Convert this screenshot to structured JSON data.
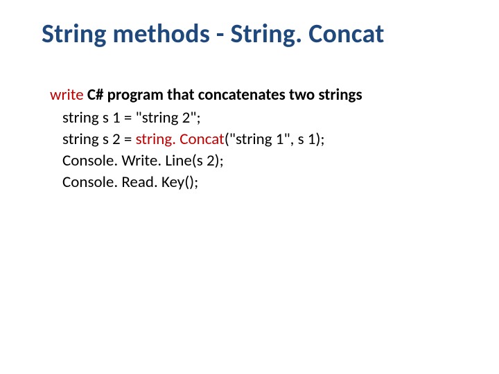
{
  "title": "String methods - String. Concat",
  "prompt_write": "write",
  "prompt_rest": "  C# program that concatenates two strings",
  "code": {
    "l1": "string s 1 = \"string 2\";",
    "l2a": "string s 2 = ",
    "l2b": "string. Concat",
    "l2c": "(\"string 1\", s 1);",
    "l3": "Console. Write. Line(s 2);",
    "l4": "Console. Read. Key();"
  }
}
